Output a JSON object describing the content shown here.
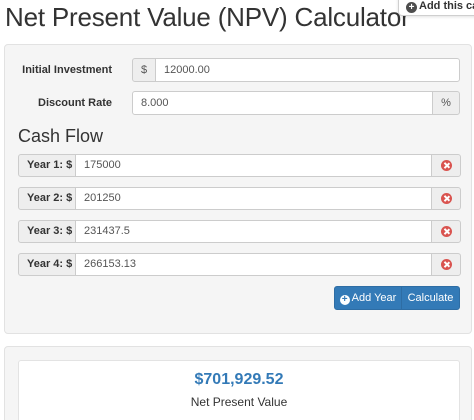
{
  "page": {
    "title": "Net Present Value (NPV) Calculator"
  },
  "widget": {
    "label": "Add this ca"
  },
  "form": {
    "initial_investment": {
      "label": "Initial Investment",
      "addon": "$",
      "value": "12000.00"
    },
    "discount_rate": {
      "label": "Discount Rate",
      "value": "8.000",
      "addon": "%"
    }
  },
  "cash_flow": {
    "title": "Cash Flow",
    "years": [
      {
        "label": "Year 1: $",
        "value": "175000"
      },
      {
        "label": "Year 2: $",
        "value": "201250"
      },
      {
        "label": "Year 3: $",
        "value": "231437.5"
      },
      {
        "label": "Year 4: $",
        "value": "266153.13"
      }
    ]
  },
  "actions": {
    "add_year": "Add Year",
    "calculate": "Calculate"
  },
  "result": {
    "value": "$701,929.52",
    "label": "Net Present Value"
  },
  "colors": {
    "accent": "#337ab7",
    "remove": "#d9534f"
  },
  "icons": {
    "add": "plus-circle-icon",
    "remove": "remove-circle-icon"
  }
}
